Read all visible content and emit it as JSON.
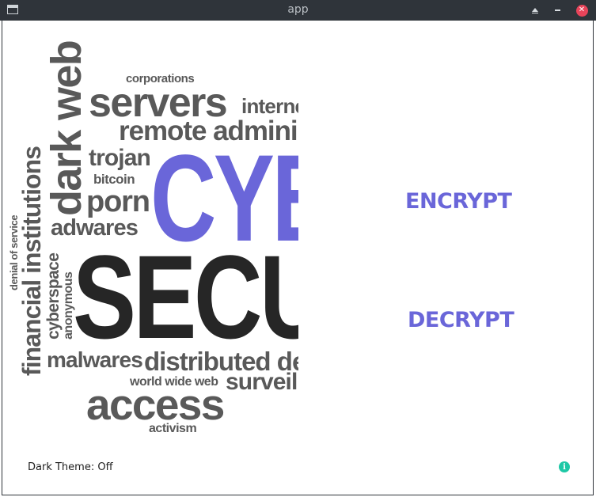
{
  "window": {
    "title": "app"
  },
  "wordcloud": {
    "words": [
      "dark web",
      "corporations",
      "servers",
      "internet",
      "remote administration",
      "trojan",
      "bitcoin",
      "porn",
      "adwares",
      "financial institutions",
      "denial of service",
      "cyberspace",
      "anonymous",
      "CYBER",
      "SECURITY",
      "malwares",
      "distributed denial",
      "world wide web",
      "surveillance",
      "access",
      "activism"
    ],
    "colors": {
      "accent": "#6a66d9",
      "dark": "#262626",
      "grey": "#595959"
    }
  },
  "actions": {
    "encrypt_label": "ENCRYPT",
    "decrypt_label": "DECRYPT"
  },
  "footer": {
    "theme_label": "Dark Theme: Off",
    "info_icon": "info-icon"
  },
  "colors": {
    "titlebar": "#2f343a",
    "accent": "#6a66d9",
    "info": "#1ec8a6",
    "close": "#e8445a"
  }
}
